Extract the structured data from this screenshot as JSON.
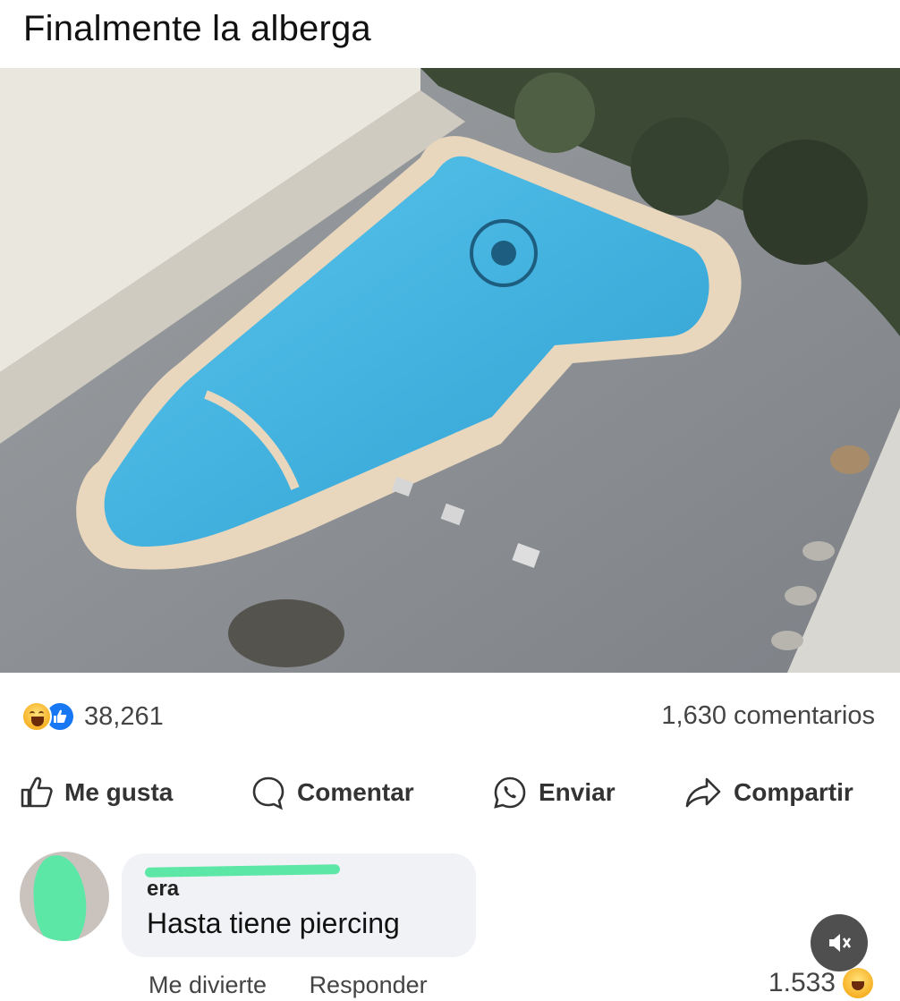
{
  "post": {
    "title": "Finalmente la alberga",
    "photo": "pool-photo"
  },
  "stats": {
    "reaction_icons": [
      "haha-icon",
      "like-icon"
    ],
    "reaction_count": "38,261",
    "comments_count": "1,630 comentarios"
  },
  "actions": {
    "like": "Me gusta",
    "comment": "Comentar",
    "send": "Enviar",
    "share": "Compartir"
  },
  "comment": {
    "author_visible": "era",
    "text": "Hasta tiene piercing",
    "reaction_link": "Me divierte",
    "reply_link": "Responder",
    "reaction_count": "1.533",
    "reaction_icon": "haha-icon",
    "mute_icon": "muted-speaker-icon"
  },
  "colors": {
    "facebook_blue": "#1877f2",
    "redaction_green": "#5ce7a7",
    "pool_blue": "#3eb5e0"
  }
}
